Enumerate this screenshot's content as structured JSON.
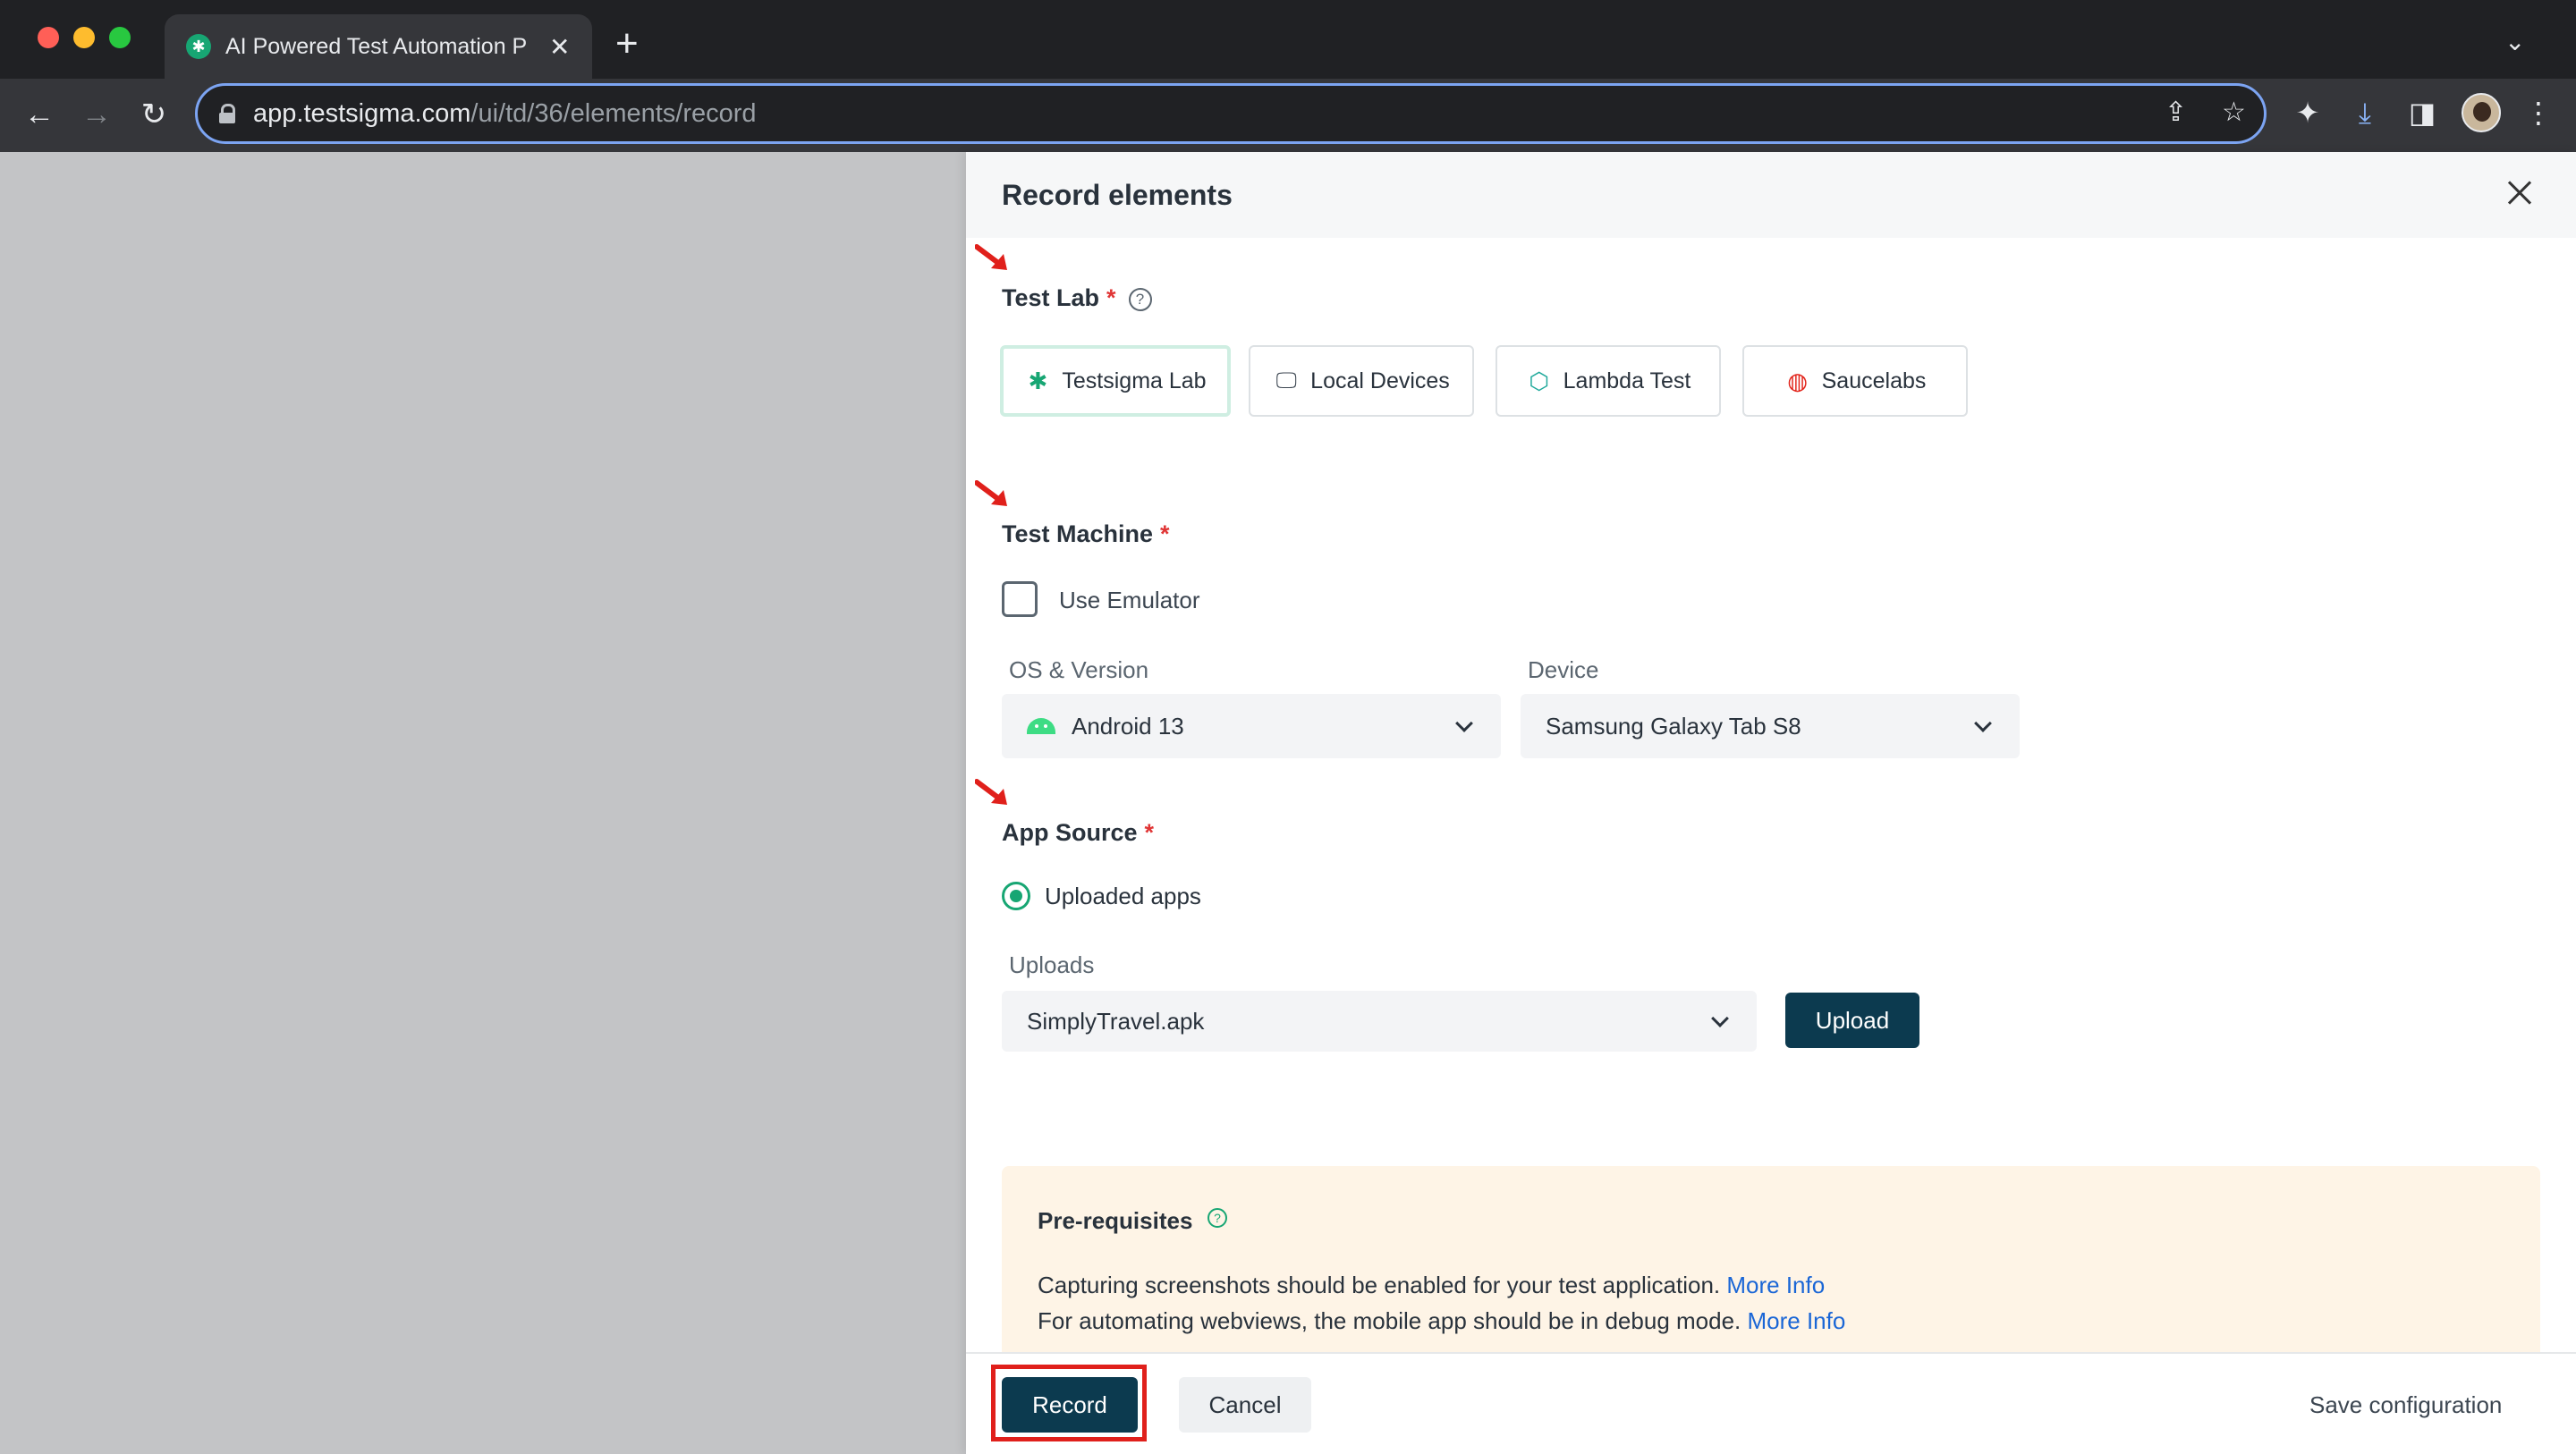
{
  "browser": {
    "tab_title": "AI Powered Test Automation P",
    "url_host": "app.testsigma.com",
    "url_path": "/ui/td/36/elements/record"
  },
  "panel": {
    "title": "Record elements",
    "test_lab": {
      "label": "Test Lab",
      "required_mark": "*",
      "help": "?",
      "options": [
        {
          "label": "Testsigma Lab",
          "icon": "testsigma-icon",
          "selected": true
        },
        {
          "label": "Local Devices",
          "icon": "local-devices-icon",
          "selected": false
        },
        {
          "label": "Lambda Test",
          "icon": "lambdatest-icon",
          "selected": false
        },
        {
          "label": "Saucelabs",
          "icon": "saucelabs-icon",
          "selected": false
        }
      ]
    },
    "test_machine": {
      "label": "Test Machine",
      "required_mark": "*",
      "use_emulator_label": "Use Emulator",
      "use_emulator_checked": false,
      "os_label": "OS & Version",
      "os_value": "Android 13",
      "device_label": "Device",
      "device_value": "Samsung Galaxy Tab S8"
    },
    "app_source": {
      "label": "App Source",
      "required_mark": "*",
      "radio_label": "Uploaded apps",
      "uploads_label": "Uploads",
      "uploads_value": "SimplyTravel.apk",
      "upload_button": "Upload"
    },
    "prereq": {
      "title": "Pre-requisites",
      "help": "?",
      "line1": "Capturing screenshots should be enabled for your test application.",
      "line2": "For automating webviews, the mobile app should be in debug mode.",
      "more_info": "More Info"
    },
    "footer": {
      "record": "Record",
      "cancel": "Cancel",
      "save_config": "Save configuration"
    }
  },
  "colors": {
    "primary": "#0c3a4f",
    "accent": "#17a673",
    "required": "#e03535",
    "link": "#1a66d6",
    "annotation": "#e0201b"
  }
}
